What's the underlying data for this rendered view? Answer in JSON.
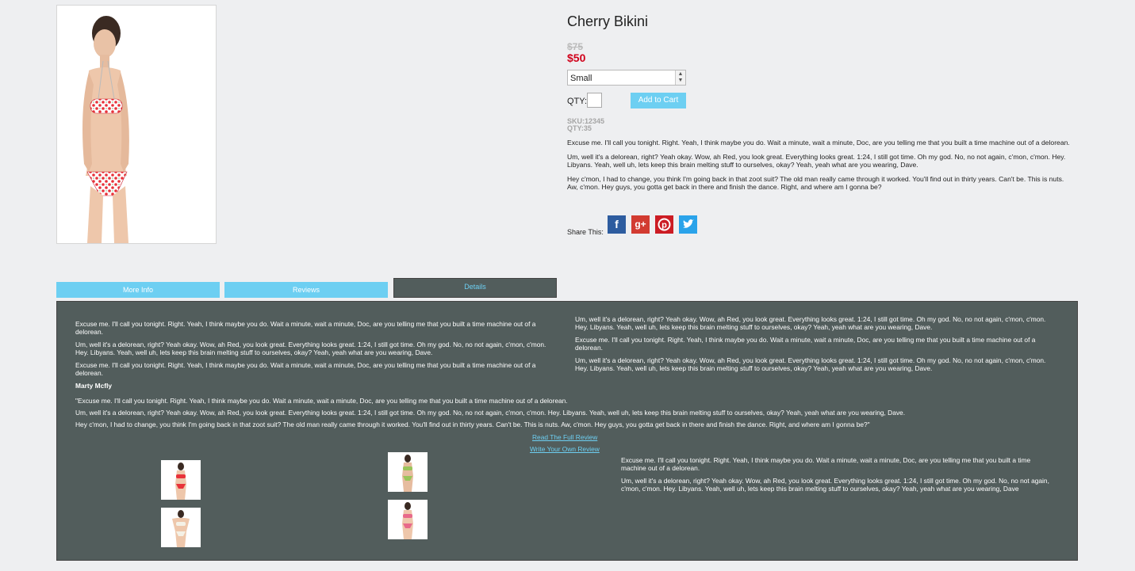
{
  "product": {
    "title": "Cherry Bikini",
    "old_price": "$75",
    "price": "$50",
    "size": {
      "selected": "Small"
    },
    "qty_label": "QTY:",
    "add_to_cart": "Add to Cart",
    "sku": "SKU:12345",
    "qty_stock": "QTY:35",
    "description": [
      "Excuse me. I'll call you tonight. Right. Yeah, I think maybe you do. Wait a minute, wait a minute, Doc, are you telling me that you built a time machine out of a delorean.",
      "Um, well it's a delorean, right? Yeah okay. Wow, ah Red, you look great. Everything looks great. 1:24, I still got time. Oh my god. No, no not again, c'mon, c'mon. Hey. Libyans. Yeah, well uh, lets keep this brain melting stuff to ourselves, okay? Yeah, yeah what are you wearing, Dave.",
      "Hey c'mon, I had to change, you think I'm going back in that zoot suit? The old man really came through it worked. You'll find out in thirty years. Can't be. This is nuts. Aw, c'mon. Hey guys, you gotta get back in there and finish the dance. Right, and where am I gonna be?"
    ],
    "share_label": "Share This:",
    "social": [
      {
        "name": "facebook-icon",
        "glyph": "f"
      },
      {
        "name": "google-plus-icon",
        "glyph": "g+"
      },
      {
        "name": "pinterest-icon",
        "glyph": "P"
      },
      {
        "name": "twitter-icon",
        "glyph": "t"
      }
    ]
  },
  "tabs": {
    "more_info": "More Info",
    "reviews": "Reviews",
    "details": "Details",
    "active": "Details"
  },
  "details": {
    "left": [
      "Excuse me. I'll call you tonight. Right. Yeah, I think maybe you do. Wait a minute, wait a minute, Doc, are you telling me that you built a time machine out of a delorean.",
      "Um, well it's a delorean, right? Yeah okay. Wow, ah Red, you look great. Everything looks great. 1:24, I still got time. Oh my god. No, no not again, c'mon, c'mon. Hey. Libyans. Yeah, well uh, lets keep this brain melting stuff to ourselves, okay? Yeah, yeah what are you wearing, Dave.",
      "Excuse me. I'll call you tonight. Right. Yeah, I think maybe you do. Wait a minute, wait a minute, Doc, are you telling me that you built a time machine out of a delorean."
    ],
    "right": [
      "Um, well it's a delorean, right? Yeah okay. Wow, ah Red, you look great. Everything looks great. 1:24, I still got time. Oh my god. No, no not again, c'mon, c'mon. Hey. Libyans. Yeah, well uh, lets keep this brain melting stuff to ourselves, okay? Yeah, yeah what are you wearing, Dave.",
      "Excuse me. I'll call you tonight. Right. Yeah, I think maybe you do. Wait a minute, wait a minute, Doc, are you telling me that you built a time machine out of a delorean.",
      "Um, well it's a delorean, right? Yeah okay. Wow, ah Red, you look great. Everything looks great. 1:24, I still got time. Oh my god. No, no not again, c'mon, c'mon. Hey. Libyans. Yeah, well uh, lets keep this brain melting stuff to ourselves, okay? Yeah, yeah what are you wearing, Dave."
    ],
    "reviewer": "Marty Mcfly",
    "review": [
      "\"Excuse me. I'll call you tonight. Right. Yeah, I think maybe you do. Wait a minute, wait a minute, Doc, are you telling me that you built a time machine out of a delorean.",
      "Um, well it's a delorean, right? Yeah okay. Wow, ah Red, you look great. Everything looks great. 1:24, I still got time. Oh my god. No, no not again, c'mon, c'mon. Hey. Libyans. Yeah, well uh, lets keep this brain melting stuff to ourselves, okay? Yeah, yeah what are you wearing, Dave.",
      "Hey c'mon, I had to change, you think I'm going back in that zoot suit? The old man really came through it worked. You'll find out in thirty years. Can't be. This is nuts. Aw, c'mon. Hey guys, you gotta get back in there and finish the dance. Right, and where am I gonna be?\""
    ],
    "read_full": "Read The Full Review",
    "write_own": "Write Your Own Review",
    "bottom": [
      "Excuse me. I'll call you tonight. Right. Yeah, I think maybe you do. Wait a minute, wait a minute, Doc, are you telling me that you built a time machine out of a delorean.",
      "Um, well it's a delorean, right? Yeah okay. Wow, ah Red, you look great. Everything looks great. 1:24, I still got time. Oh my god. No, no not again, c'mon, c'mon. Hey. Libyans. Yeah, well uh, lets keep this brain melting stuff to ourselves, okay? Yeah, yeah what are you wearing, Dave"
    ]
  },
  "colors": {
    "accent": "#6dcff2",
    "panel": "#525d5c",
    "price": "#d0021b",
    "background": "#eeeff1"
  }
}
